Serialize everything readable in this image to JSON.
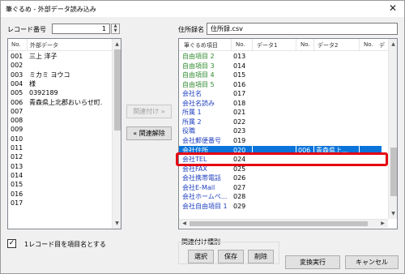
{
  "window": {
    "title": "筆ぐるめ - 外部データ読み込み",
    "close_glyph": "✕"
  },
  "left_panel": {
    "record_label": "レコード番号",
    "record_value": "1",
    "header": {
      "no": "No.",
      "data": "外部データ"
    },
    "rows": [
      {
        "no": "001",
        "data": "三上 洋子"
      },
      {
        "no": "002",
        "data": ""
      },
      {
        "no": "003",
        "data": "ミカミ ヨウコ"
      },
      {
        "no": "004",
        "data": "様"
      },
      {
        "no": "005",
        "data": "0392189"
      },
      {
        "no": "006",
        "data": "青森県上北郡おいらせ町..."
      },
      {
        "no": "007",
        "data": ""
      },
      {
        "no": "008",
        "data": ""
      },
      {
        "no": "009",
        "data": ""
      },
      {
        "no": "010",
        "data": ""
      },
      {
        "no": "011",
        "data": ""
      },
      {
        "no": "012",
        "data": ""
      },
      {
        "no": "013",
        "data": ""
      },
      {
        "no": "014",
        "data": ""
      },
      {
        "no": "015",
        "data": ""
      },
      {
        "no": "016",
        "data": ""
      },
      {
        "no": "017",
        "data": ""
      }
    ]
  },
  "middle": {
    "link_button": "関連付け »",
    "unlink_button": "« 関連解除"
  },
  "right_panel": {
    "filename_label": "住所録名",
    "filename_value": "住所録.csv",
    "header": {
      "item": "筆ぐるめ項目",
      "no": "No.",
      "data1": "データ1",
      "no2": "No.",
      "data2": "データ2",
      "no3": "No.",
      "data3": "デ"
    },
    "rows": [
      {
        "item": "自由項目 2",
        "no": "013",
        "color": "#2f8a2f",
        "d2no": "",
        "d2": ""
      },
      {
        "item": "自由項目 3",
        "no": "014",
        "color": "#2f8a2f",
        "d2no": "",
        "d2": ""
      },
      {
        "item": "自由項目 4",
        "no": "015",
        "color": "#2f8a2f",
        "d2no": "",
        "d2": ""
      },
      {
        "item": "自由項目 5",
        "no": "016",
        "color": "#2f8a2f",
        "d2no": "",
        "d2": ""
      },
      {
        "item": "会社名",
        "no": "017",
        "color": "#1f3fbf",
        "d2no": "",
        "d2": ""
      },
      {
        "item": "会社名読み",
        "no": "018",
        "color": "#1f3fbf",
        "d2no": "",
        "d2": ""
      },
      {
        "item": "所属 1",
        "no": "021",
        "color": "#1f3fbf",
        "d2no": "",
        "d2": ""
      },
      {
        "item": "所属 2",
        "no": "022",
        "color": "#1f3fbf",
        "d2no": "",
        "d2": ""
      },
      {
        "item": "役職",
        "no": "023",
        "color": "#1f3fbf",
        "d2no": "",
        "d2": ""
      },
      {
        "item": "会社郵便番号",
        "no": "019",
        "color": "#1f3fbf",
        "d2no": "",
        "d2": ""
      },
      {
        "item": "会社住所",
        "no": "020",
        "color": "#ffffff",
        "d2no": "006",
        "d2": "青森県上...",
        "selected": true
      },
      {
        "item": "会社TEL",
        "no": "024",
        "color": "#1f3fbf",
        "d2no": "",
        "d2": ""
      },
      {
        "item": "会社FAX",
        "no": "025",
        "color": "#1f3fbf",
        "d2no": "",
        "d2": ""
      },
      {
        "item": "会社携帯電話",
        "no": "026",
        "color": "#1f3fbf",
        "d2no": "",
        "d2": ""
      },
      {
        "item": "会社E-Mail",
        "no": "027",
        "color": "#1f3fbf",
        "d2no": "",
        "d2": ""
      },
      {
        "item": "会社ホームペ...",
        "no": "028",
        "color": "#1f3fbf",
        "d2no": "",
        "d2": ""
      },
      {
        "item": "会社自由項目 1",
        "no": "029",
        "color": "#1f3fbf",
        "d2no": "",
        "d2": ""
      }
    ]
  },
  "bottom": {
    "checkbox_checked_glyph": "✓",
    "checkbox_label": "1レコード目を項目名とする",
    "group_label": "関連付け種別",
    "select_button": "選択",
    "save_button": "保存",
    "delete_button": "削除",
    "execute_button": "変換実行",
    "cancel_button": "キャンセル"
  },
  "colors": {
    "selection": "#0a74da",
    "highlight_border": "#e60012"
  }
}
